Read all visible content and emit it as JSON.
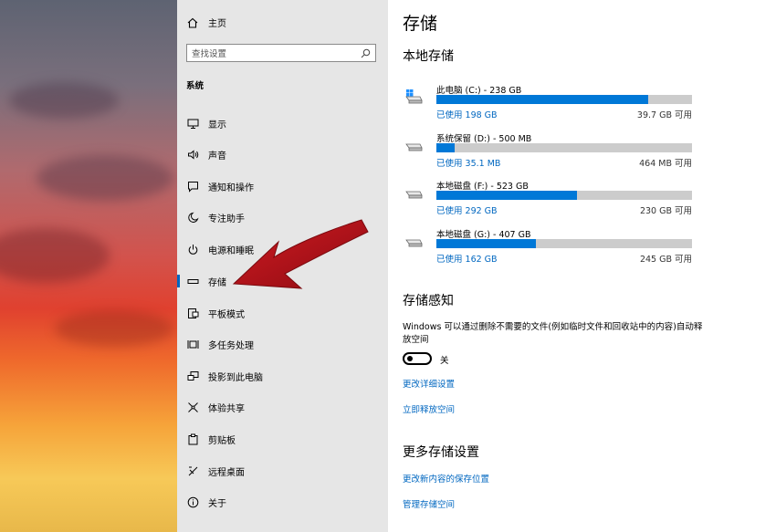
{
  "sidebar": {
    "home_label": "主页",
    "search_placeholder": "查找设置",
    "section_title": "系统",
    "items": [
      {
        "label": "显示",
        "icon": "monitor-icon"
      },
      {
        "label": "声音",
        "icon": "speaker-icon"
      },
      {
        "label": "通知和操作",
        "icon": "notification-icon"
      },
      {
        "label": "专注助手",
        "icon": "moon-icon"
      },
      {
        "label": "电源和睡眠",
        "icon": "power-icon"
      },
      {
        "label": "存储",
        "icon": "storage-icon",
        "active": true
      },
      {
        "label": "平板模式",
        "icon": "tablet-mode-icon"
      },
      {
        "label": "多任务处理",
        "icon": "multitask-icon"
      },
      {
        "label": "投影到此电脑",
        "icon": "project-icon"
      },
      {
        "label": "体验共享",
        "icon": "share-icon"
      },
      {
        "label": "剪贴板",
        "icon": "clipboard-icon"
      },
      {
        "label": "远程桌面",
        "icon": "remote-desktop-icon"
      },
      {
        "label": "关于",
        "icon": "info-icon"
      }
    ]
  },
  "main": {
    "title": "存储",
    "local_storage_title": "本地存储",
    "drives": [
      {
        "name": "此电脑 (C:) - 238 GB",
        "used": "已使用 198 GB",
        "free": "39.7 GB 可用",
        "fraction": 0.83,
        "icon": "windows-drive-icon"
      },
      {
        "name": "系统保留 (D:) - 500 MB",
        "used": "已使用 35.1 MB",
        "free": "464 MB 可用",
        "fraction": 0.07,
        "icon": "drive-icon"
      },
      {
        "name": "本地磁盘 (F:) - 523 GB",
        "used": "已使用 292 GB",
        "free": "230 GB 可用",
        "fraction": 0.55,
        "icon": "drive-icon"
      },
      {
        "name": "本地磁盘 (G:) - 407 GB",
        "used": "已使用 162 GB",
        "free": "245 GB 可用",
        "fraction": 0.39,
        "icon": "drive-icon"
      }
    ],
    "storage_sense_title": "存储感知",
    "storage_sense_desc": "Windows 可以通过删除不需要的文件(例如临时文件和回收站中的内容)自动释放空间",
    "toggle_label": "关",
    "toggle_on": false,
    "link_change_settings": "更改详细设置",
    "link_free_now": "立即释放空间",
    "more_settings_title": "更多存储设置",
    "link_change_save_location": "更改新内容的保存位置",
    "link_manage_spaces": "管理存储空间"
  },
  "colors": {
    "accent": "#0078d7",
    "link": "#0067c0",
    "arrow": "#c0101a",
    "sidebar_bg": "#e6e6e6"
  }
}
